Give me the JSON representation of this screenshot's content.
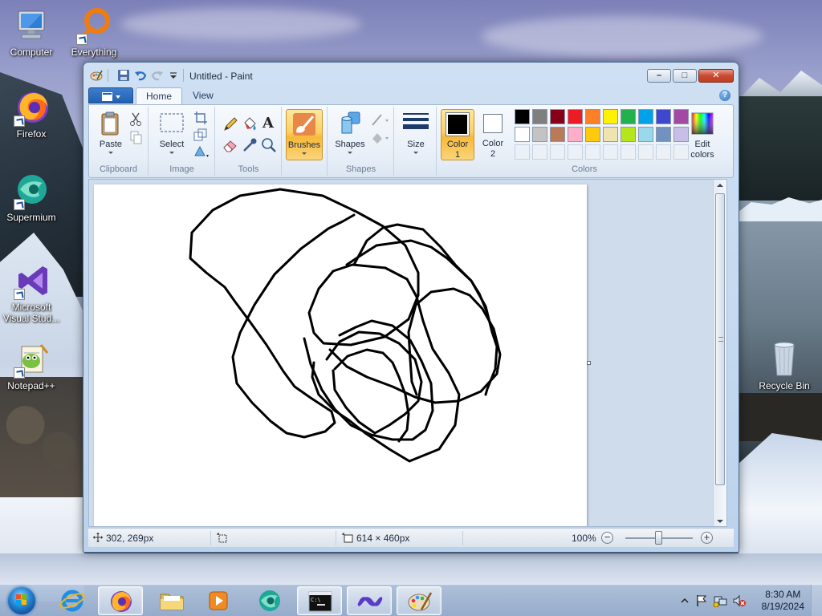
{
  "desktop": {
    "icons": [
      {
        "label": "Computer"
      },
      {
        "label": "Everything"
      },
      {
        "label": "Firefox"
      },
      {
        "label": "Supermium"
      },
      {
        "label": "Microsoft Visual Stud..."
      },
      {
        "label": "Notepad++"
      },
      {
        "label": "Recycle Bin"
      }
    ]
  },
  "window": {
    "title": "Untitled - Paint",
    "controls": {
      "minimize": "–",
      "maximize": "□",
      "close": "✕"
    }
  },
  "ribbon": {
    "tabs": [
      {
        "label": "Home"
      },
      {
        "label": "View"
      }
    ],
    "help": "?",
    "groups": {
      "clipboard": {
        "label": "Clipboard",
        "paste": "Paste"
      },
      "image": {
        "label": "Image",
        "select": "Select"
      },
      "tools": {
        "label": "Tools",
        "text_tool": "A"
      },
      "brushes": {
        "label": "Brushes"
      },
      "shapes": {
        "label": "Shapes",
        "button": "Shapes"
      },
      "size": {
        "label": "Size"
      },
      "colors": {
        "label": "Colors",
        "color1": "Color 1",
        "color2": "Color 2",
        "edit_colors": "Edit colors",
        "color1_value": "#000000",
        "color2_value": "#ffffff",
        "palette_row1": [
          "#000000",
          "#7f7f7f",
          "#880015",
          "#ed1c24",
          "#ff7f27",
          "#fff200",
          "#22b14c",
          "#00a2e8",
          "#3f48cc",
          "#a349a4"
        ],
        "palette_row2": [
          "#ffffff",
          "#c3c3c3",
          "#b97a57",
          "#ffaec9",
          "#ffc90e",
          "#efe4b0",
          "#b5e61d",
          "#99d9ea",
          "#7092be",
          "#c8bfe7"
        ]
      }
    }
  },
  "statusbar": {
    "cursor_pos": "302, 269px",
    "selection_size": "",
    "canvas_size": "614 × 460px",
    "zoom": "100%",
    "zoom_out": "−",
    "zoom_in": "+"
  },
  "taskbar": {
    "apps": [
      "internet-explorer",
      "firefox",
      "file-explorer",
      "media-player",
      "supermium",
      "command-prompt",
      "visual-studio",
      "paint"
    ],
    "clock_time": "8:30 AM",
    "clock_date": "8/19/2024"
  },
  "colors": {
    "accent": "#2360b2",
    "ribbon_selected": "#fbcf63"
  }
}
